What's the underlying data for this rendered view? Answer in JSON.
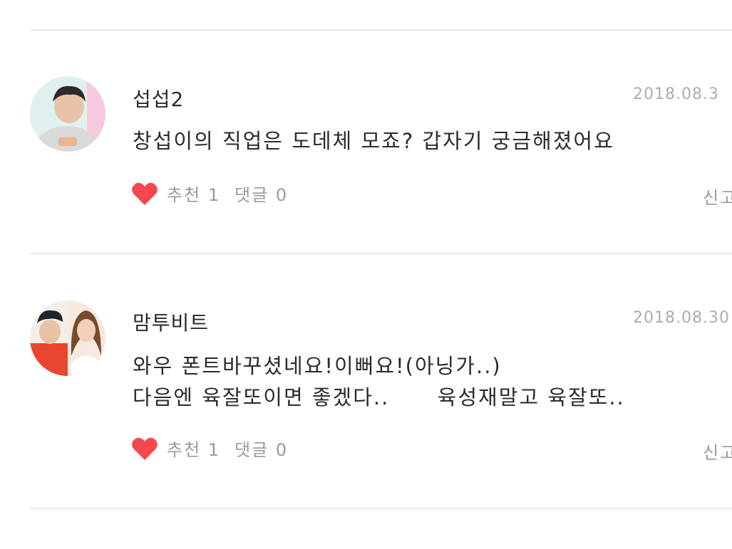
{
  "comments": [
    {
      "author": "섭섭2",
      "date": "2018.08.3",
      "text": "창섭이의 직업은 도데체 모죠? 갑자기 궁금해졌어요",
      "like_label": "추천",
      "like_count": "1",
      "reply_label": "댓글",
      "reply_count": "0",
      "report_label": "신고"
    },
    {
      "author": "맘투비트",
      "date": "2018.08.30",
      "text": "와우 폰트바꾸셨네요!이뻐요!(아닝가..)\n다음엔 육잘또이면 좋겠다..      육성재말고 육잘또..",
      "like_label": "추천",
      "like_count": "1",
      "reply_label": "댓글",
      "reply_count": "0",
      "report_label": "신고"
    }
  ],
  "colors": {
    "heart": "#f4484f",
    "divider": "#e9e9e9",
    "muted_text": "#9a9a9a",
    "date_text": "#a9adb2"
  }
}
